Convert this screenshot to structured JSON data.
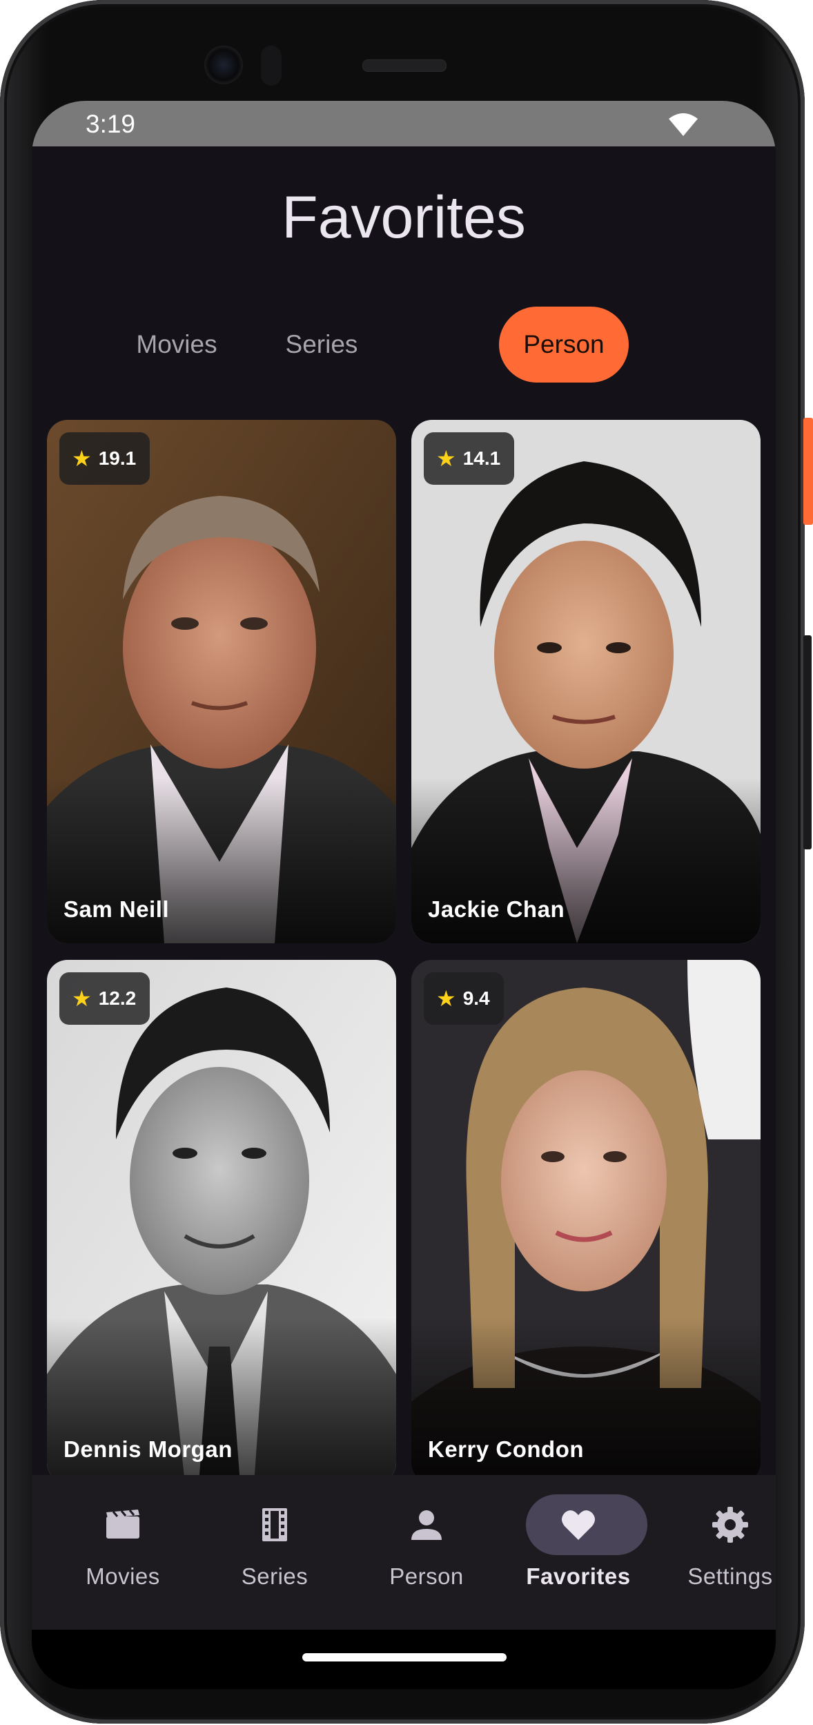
{
  "status_bar": {
    "time": "3:19"
  },
  "header": {
    "title": "Favorites"
  },
  "filter_chips": [
    {
      "label": "Movies",
      "selected": false
    },
    {
      "label": "Series",
      "selected": false
    },
    {
      "label": "Person",
      "selected": true
    }
  ],
  "people": [
    {
      "name": "Sam Neill",
      "rating": "19.1"
    },
    {
      "name": "Jackie Chan",
      "rating": "14.1"
    },
    {
      "name": "Dennis Morgan",
      "rating": "12.2"
    },
    {
      "name": "Kerry Condon",
      "rating": "9.4"
    }
  ],
  "bottom_nav": [
    {
      "label": "Movies",
      "icon": "movie-clapper-icon",
      "selected": false
    },
    {
      "label": "Series",
      "icon": "film-strip-icon",
      "selected": false
    },
    {
      "label": "Person",
      "icon": "person-icon",
      "selected": false
    },
    {
      "label": "Favorites",
      "icon": "heart-icon",
      "selected": true
    },
    {
      "label": "Settings",
      "icon": "gear-icon",
      "selected": false
    }
  ],
  "colors": {
    "accent": "#ff6a35",
    "background": "#141218",
    "rating_star": "#ffd21a",
    "nav_active_pill": "#4a4458"
  }
}
